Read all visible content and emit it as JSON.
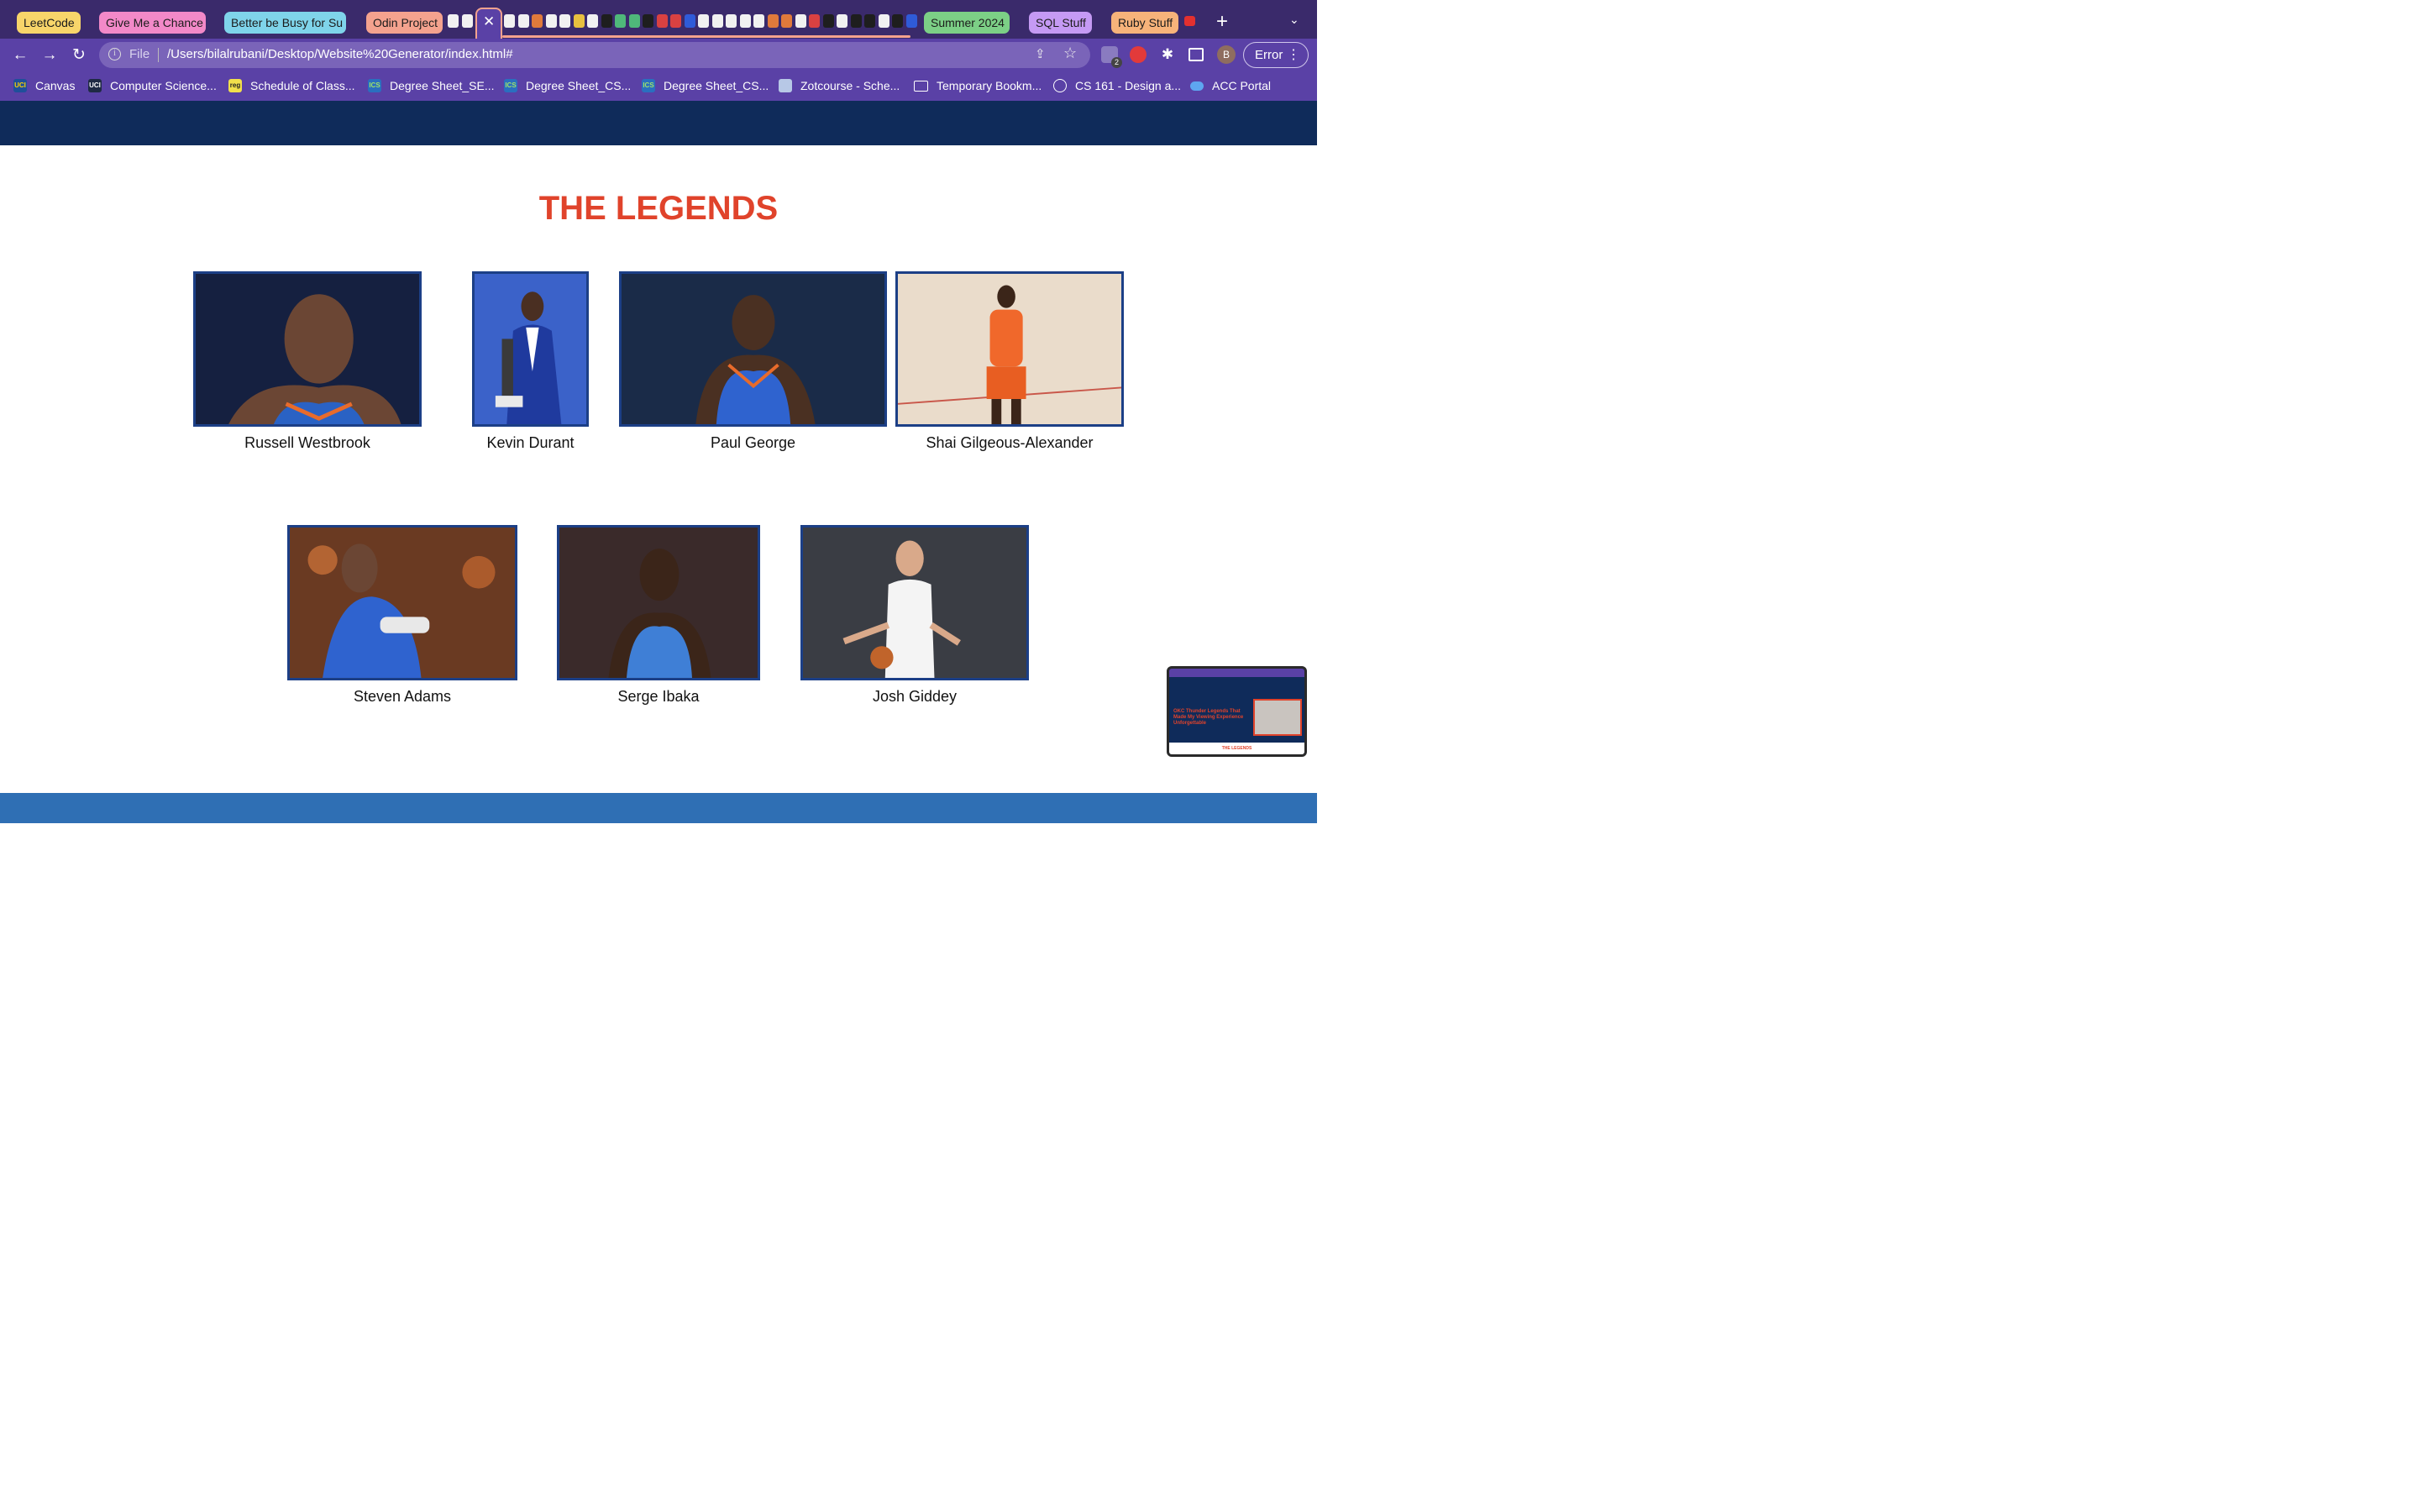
{
  "browser": {
    "tab_groups": [
      "LeetCode",
      "Give Me a Chance",
      "Better be Busy for Su",
      "Odin Project",
      "Summer 2024",
      "SQL Stuff",
      "Ruby Stuff"
    ],
    "address": {
      "scheme_label": "File",
      "url": "/Users/bilalrubani/Desktop/Website%20Generator/index.html#"
    },
    "extension_badge": "2",
    "profile_initial": "B",
    "error_label": "Error"
  },
  "bookmarks": [
    "Canvas",
    "Computer Science...",
    "Schedule of Class...",
    "Degree Sheet_SE...",
    "Degree Sheet_CS...",
    "Degree Sheet_CS...",
    "Zotcourse - Sche...",
    "Temporary Bookm...",
    "CS 161 - Design a...",
    "ACC Portal"
  ],
  "section": {
    "title": "THE LEGENDS"
  },
  "players": [
    {
      "name": "Russell Westbrook"
    },
    {
      "name": "Kevin Durant"
    },
    {
      "name": "Paul George"
    },
    {
      "name": "Shai Gilgeous-Alexander"
    },
    {
      "name": "Steven Adams"
    },
    {
      "name": "Serge Ibaka"
    },
    {
      "name": "Josh Giddey"
    }
  ],
  "pip_preview": {
    "heading": "OKC Thunder Legends That Made My Viewing Experience Unforgettable",
    "footer": "THE LEGENDS"
  },
  "colors": {
    "accent_red": "#e0432b",
    "navy": "#0f2b5a",
    "browser_purple": "#5a41a6",
    "thunder_blue": "#2f6fb4"
  }
}
